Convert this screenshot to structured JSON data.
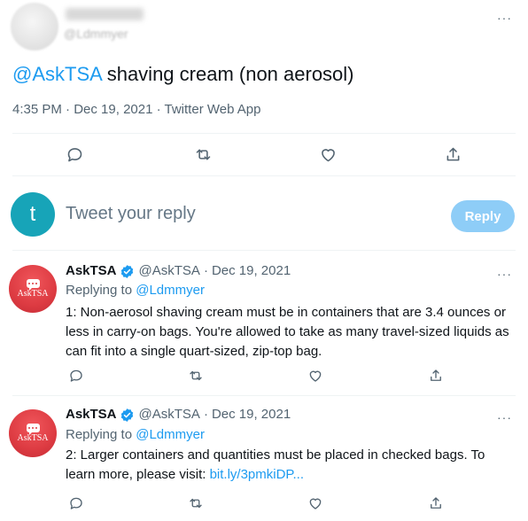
{
  "main_tweet": {
    "handle": "@Ldmmyer",
    "mention": "@AskTSA",
    "text": " shaving cream (non aerosol)",
    "time": "4:35 PM",
    "sep1": " · ",
    "date": "Dec 19, 2021",
    "sep2": " · ",
    "source": "Twitter Web App",
    "more": "···"
  },
  "icons": {
    "reply": "reply-icon",
    "retweet": "retweet-icon",
    "like": "heart-icon",
    "share": "share-icon",
    "verified": "verified-badge-icon",
    "more": "more-icon"
  },
  "reply_box": {
    "avatar_letter": "t",
    "placeholder": "Tweet your reply",
    "button": "Reply"
  },
  "replies": [
    {
      "avatar_text": "AskTSA",
      "name": "AskTSA",
      "handle": "@AskTSA",
      "sep": "·",
      "date": "Dec 19, 2021",
      "replying_label": "Replying to ",
      "replying_handle": "@Ldmmyer",
      "text": "1: Non-aerosol shaving cream must be in containers that are 3.4 ounces or less in carry-on bags. You're allowed to take as many travel-sized liquids as can fit into a single quart-sized, zip-top bag.",
      "link": "",
      "more": "···"
    },
    {
      "avatar_text": "AskTSA",
      "name": "AskTSA",
      "handle": "@AskTSA",
      "sep": "·",
      "date": "Dec 19, 2021",
      "replying_label": "Replying to ",
      "replying_handle": "@Ldmmyer",
      "text": "2: Larger containers and quantities must be placed in checked bags. To learn more, please visit: ",
      "link": "bit.ly/3pmkiDP...",
      "more": "···"
    }
  ],
  "colors": {
    "accent": "#1d9bf0",
    "reply_button_disabled": "#8ecdf7",
    "tsa_red": "#dd3b42",
    "reply_avatar": "#17a4b8",
    "secondary_text": "#536471"
  }
}
